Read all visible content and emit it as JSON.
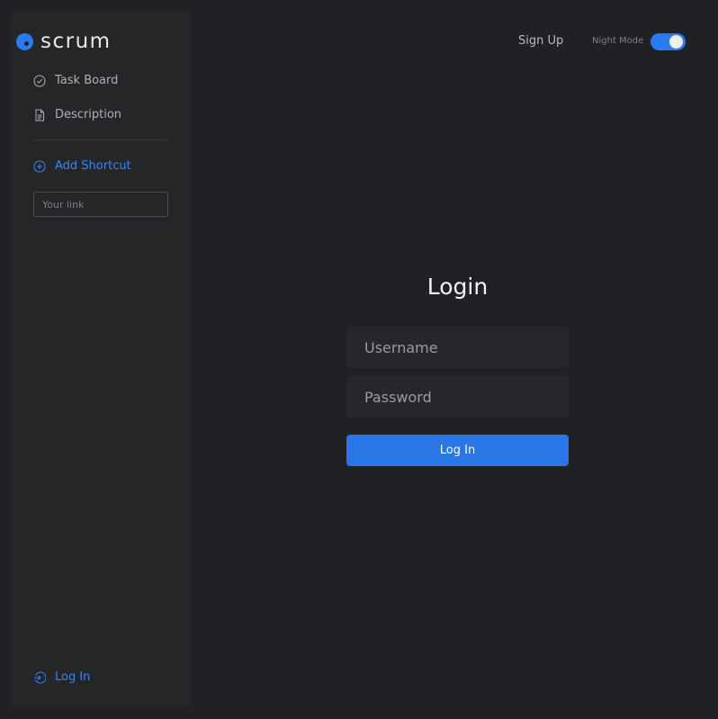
{
  "brand": {
    "name": "scrum",
    "accent": "#2b7bf0"
  },
  "sidebar": {
    "items": [
      {
        "label": "Task Board",
        "icon": "check-circle-icon"
      },
      {
        "label": "Description",
        "icon": "document-icon"
      }
    ],
    "shortcut": {
      "label": "Add Shortcut",
      "icon": "plus-circle-icon"
    },
    "link_input": {
      "placeholder": "Your link",
      "value": ""
    },
    "footer": {
      "label": "Log In",
      "icon": "login-icon"
    }
  },
  "header": {
    "signup_label": "Sign Up",
    "night_mode_label": "Night Mode",
    "night_mode_on": true
  },
  "login": {
    "title": "Login",
    "username_placeholder": "Username",
    "password_placeholder": "Password",
    "button_label": "Log In"
  }
}
